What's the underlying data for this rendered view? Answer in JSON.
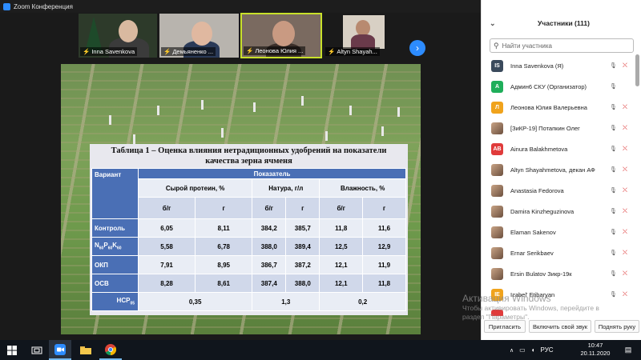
{
  "window": {
    "title": "Zoom Конференция",
    "controls": [
      "—",
      "☐",
      "✕"
    ]
  },
  "video_strip": {
    "tiles": [
      {
        "name": "Inna Savenkova",
        "active": false
      },
      {
        "name": "Демьяненко ...",
        "active": false
      },
      {
        "name": "Леонова Юлия ...",
        "active": true
      },
      {
        "name": "Altyn Shayah...",
        "active": false
      }
    ],
    "next_label": "›"
  },
  "slide": {
    "table_title_line1": "Таблица 1 – Оценка влияния нетрадиционных удобрений на показатели",
    "table_title_line2": "качества зерна ячменя",
    "header_variant": "Вариант",
    "header_indicator": "Показатель",
    "col_groups": [
      "Сырой протеин, %",
      "Натура, г/л",
      "Влажность, %"
    ],
    "sub_cols": [
      "б/г",
      "г",
      "б/г",
      "г",
      "б/г",
      "г"
    ],
    "rows": [
      {
        "label": "Контроль",
        "values": [
          "6,05",
          "8,11",
          "384,2",
          "385,7",
          "11,8",
          "11,6"
        ]
      },
      {
        "label": "N60P60K60",
        "values": [
          "5,58",
          "6,78",
          "388,0",
          "389,4",
          "12,5",
          "12,9"
        ]
      },
      {
        "label": "ОКП",
        "values": [
          "7,91",
          "8,95",
          "386,7",
          "387,2",
          "12,1",
          "11,9"
        ]
      },
      {
        "label": "ОСВ",
        "values": [
          "8,28",
          "8,61",
          "387,4",
          "388,0",
          "12,1",
          "11,8"
        ]
      }
    ],
    "nsr_label": "НСР05",
    "nsr_values": [
      "0,35",
      "1,3",
      "0,2"
    ]
  },
  "participants": {
    "title": "Участники (111)",
    "search_placeholder": "Найти участника",
    "items": [
      {
        "initials": "IS",
        "color": "#3a4a5c",
        "name": "Inna Savenkova (Я)",
        "video": true
      },
      {
        "initials": "А",
        "color": "#1fae5a",
        "name": "Админ6 СКУ (Организатор)",
        "video": false
      },
      {
        "initials": "Л",
        "color": "#f0a31c",
        "name": "Леонова Юлия Валерьевна",
        "video": true
      },
      {
        "initials": "",
        "color": "photo",
        "name": "[ЗиКР-19] Потапкин Олег",
        "video": true
      },
      {
        "initials": "AB",
        "color": "#e03b3b",
        "name": "Ainura Balakhmetova",
        "video": true
      },
      {
        "initials": "",
        "color": "photo",
        "name": "Altyn Shayahmetova, декан АФ",
        "video": true
      },
      {
        "initials": "",
        "color": "photo",
        "name": "Anastasia Fedorova",
        "video": true
      },
      {
        "initials": "",
        "color": "photo",
        "name": "Damira Kinzheguzinova",
        "video": true
      },
      {
        "initials": "",
        "color": "photo",
        "name": "Elaman Sakenov",
        "video": true
      },
      {
        "initials": "",
        "color": "photo",
        "name": "Ernar Serikbaev",
        "video": true
      },
      {
        "initials": "",
        "color": "photo",
        "name": "Ersin Bulatov Зикр-19к",
        "video": true
      },
      {
        "initials": "IE",
        "color": "#f0a31c",
        "name": "Izabel' Etibaryan",
        "video": true
      },
      {
        "initials": "",
        "color": "#e03b3b",
        "name": "",
        "video": true
      }
    ],
    "buttons": [
      "Пригласить",
      "Включить свой звук",
      "Поднять руку"
    ]
  },
  "watermark": {
    "line1": "Активация Windows",
    "line2": "Чтобы активировать Windows, перейдите в",
    "line3": "раздел \"Параметры\"."
  },
  "taskbar": {
    "language": "РУС",
    "time": "10:47",
    "date": "20.11.2020"
  }
}
